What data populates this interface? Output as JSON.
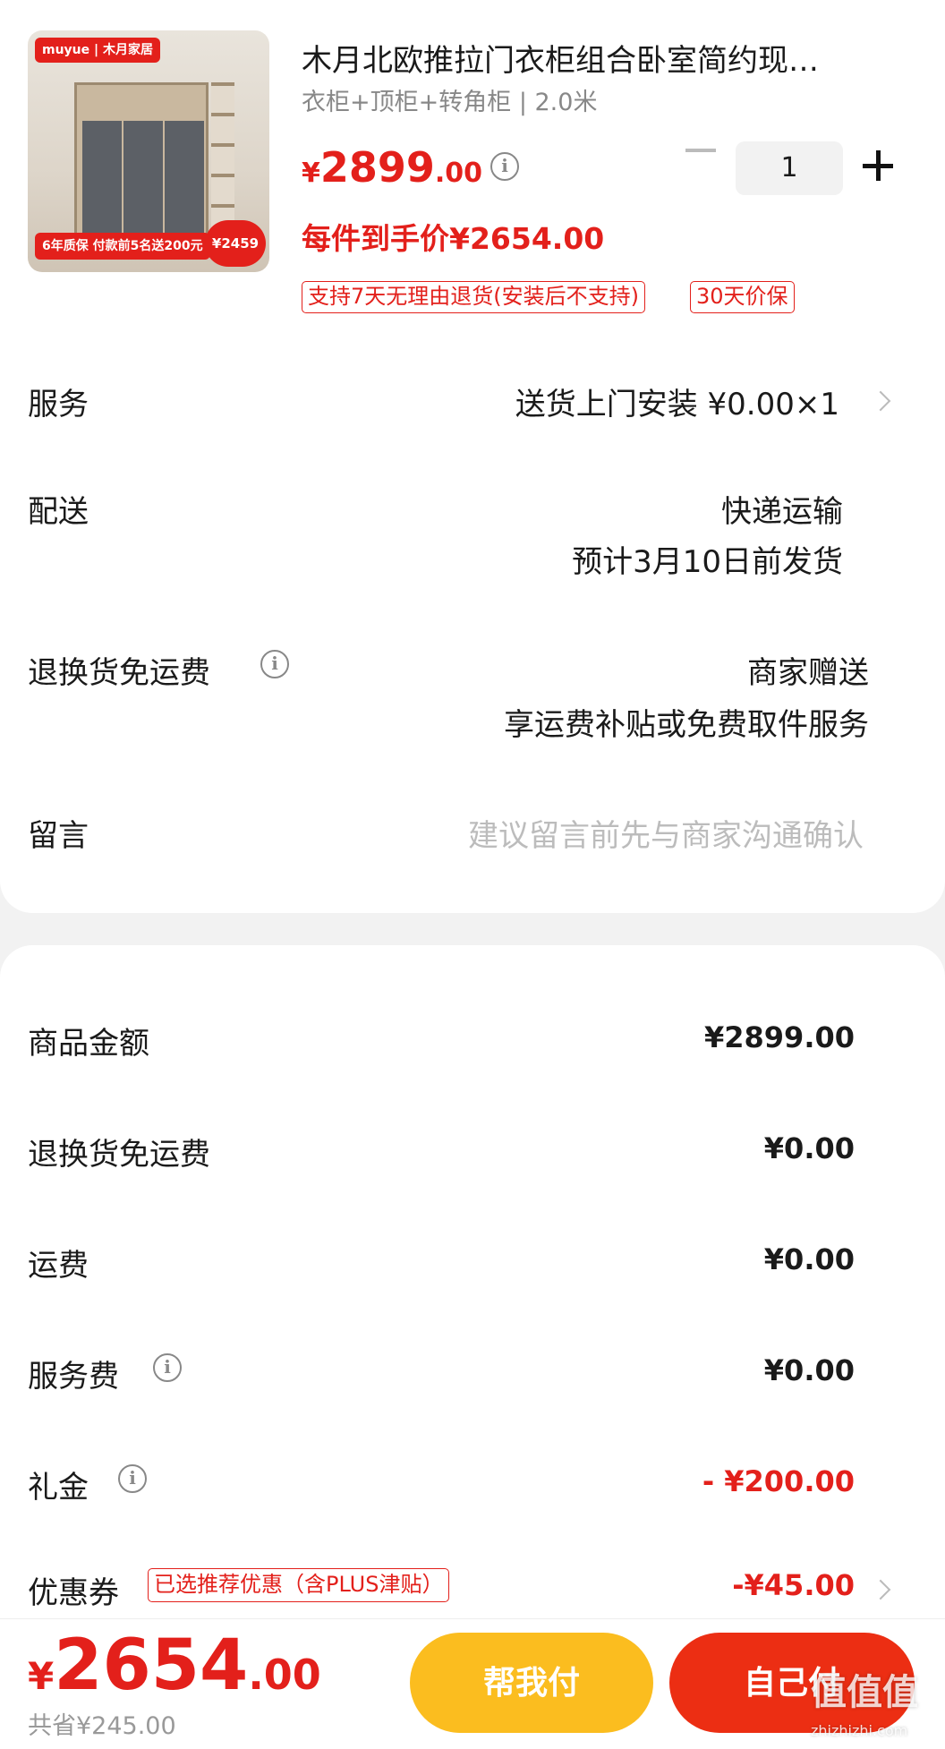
{
  "product": {
    "title": "木月北欧推拉门衣柜组合卧室简约现…",
    "spec": "衣柜+顶柜+转角柜 | 2.0米",
    "price_symbol": "¥",
    "price_int": "2899",
    "price_dec": ".00",
    "quantity": "1",
    "per_item_price": "每件到手价¥2654.00",
    "tags": [
      "支持7天无理由退货(安装后不支持)",
      "30天价保"
    ],
    "image": {
      "brand": "muyue | 木月家居",
      "badge": "6年质保 付款前5名送200元",
      "price_bubble": "¥2459"
    }
  },
  "rows": {
    "service_label": "服务",
    "service_value": "送货上门安装  ¥0.00×1",
    "delivery_label": "配送",
    "delivery_method": "快递运输",
    "delivery_eta": "预计3月10日前发货",
    "return_label": "退换货免运费",
    "return_value1": "商家赠送",
    "return_value2": "享运费补贴或免费取件服务",
    "message_label": "留言",
    "message_placeholder": "建议留言前先与商家沟通确认"
  },
  "summary": {
    "goods_label": "商品金额",
    "goods_value": "¥2899.00",
    "return_label": "退换货免运费",
    "return_value": "¥0.00",
    "shipping_label": "运费",
    "shipping_value": "¥0.00",
    "service_fee_label": "服务费",
    "service_fee_value": "¥0.00",
    "gift_label": "礼金",
    "gift_value": "- ¥200.00",
    "coupon_label": "优惠券",
    "coupon_tag": "已选推荐优惠（含PLUS津贴）",
    "coupon_value": "-¥45.00"
  },
  "footer": {
    "total_symbol": "¥",
    "total_int": "2654",
    "total_dec": ".00",
    "saved": "共省¥245.00",
    "help_pay_label": "帮我付",
    "self_pay_label": "自己付",
    "watermark": "值值值",
    "watermark_sub": "zhizhizhi.com"
  },
  "colors": {
    "accent_red": "#e3201b",
    "help_button": "#fbbd1f",
    "self_button": "#ec2e13"
  }
}
